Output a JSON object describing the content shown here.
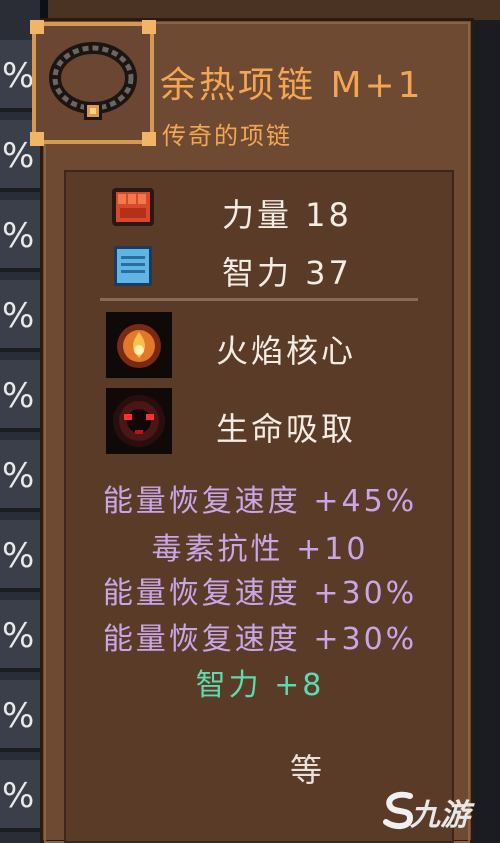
{
  "left_column": {
    "percent_symbol": "%",
    "rows": 11
  },
  "item": {
    "name": "余热项链 M+1",
    "subtitle": "传奇的项链",
    "icon": "necklace-icon"
  },
  "base_stats": [
    {
      "icon": "fist-icon",
      "label": "力量 18"
    },
    {
      "icon": "book-icon",
      "label": "智力 37"
    }
  ],
  "skills": [
    {
      "icon": "flame-core-icon",
      "label": "火焰核心"
    },
    {
      "icon": "life-drain-icon",
      "label": "生命吸取"
    }
  ],
  "affixes": [
    {
      "text": "能量恢复速度 +45%",
      "color": "#c9a6e6"
    },
    {
      "text": "毒素抗性 +10",
      "color": "#c9a6e6"
    },
    {
      "text": "能量恢复速度 +30%",
      "color": "#c9a6e6"
    },
    {
      "text": "能量恢复速度 +30%",
      "color": "#c9a6e6"
    },
    {
      "text": "智力 +8",
      "color": "#5ed9b0"
    }
  ],
  "level_label": "等",
  "watermark": "九游",
  "colors": {
    "panel": "#6e4a32",
    "inner_panel": "#5a3b27",
    "title": "#f2a654",
    "affix_purple": "#c9a6e6",
    "affix_green": "#5ed9b0"
  }
}
